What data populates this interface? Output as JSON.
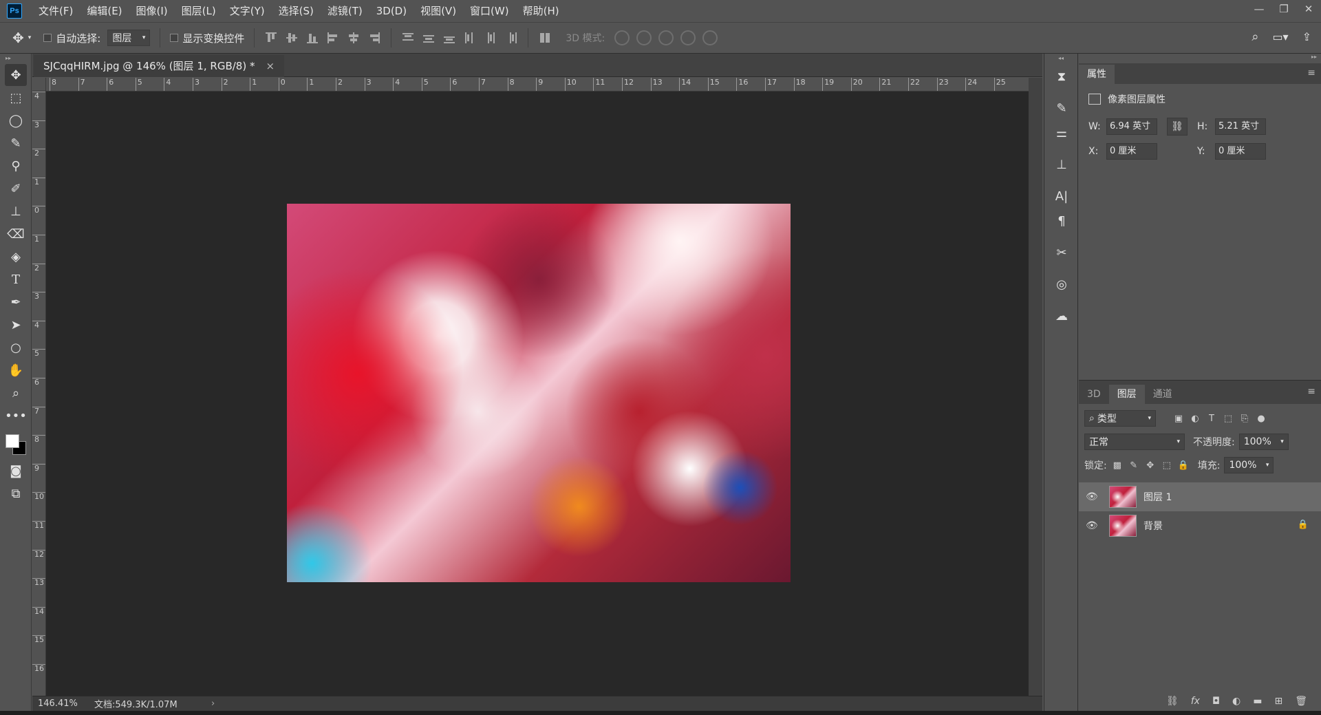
{
  "app": {
    "logo": "Ps"
  },
  "menu": [
    "文件(F)",
    "编辑(E)",
    "图像(I)",
    "图层(L)",
    "文字(Y)",
    "选择(S)",
    "滤镜(T)",
    "3D(D)",
    "视图(V)",
    "窗口(W)",
    "帮助(H)"
  ],
  "options": {
    "auto_select_label": "自动选择:",
    "auto_select_value": "图层",
    "show_transform_label": "显示变换控件",
    "mode_3d_label": "3D 模式:"
  },
  "document": {
    "tab_title": "SJCqqHIRM.jpg @ 146% (图层 1, RGB/8) *",
    "close_glyph": "×"
  },
  "rulers": {
    "horizontal": [
      "8",
      "7",
      "6",
      "5",
      "4",
      "3",
      "2",
      "1",
      "0",
      "1",
      "2",
      "3",
      "4",
      "5",
      "6",
      "7",
      "8",
      "9",
      "10",
      "11",
      "12",
      "13",
      "14",
      "15",
      "16",
      "17",
      "18",
      "19",
      "20",
      "21",
      "22",
      "23",
      "24",
      "25"
    ],
    "vertical": [
      "4",
      "3",
      "2",
      "1",
      "0",
      "1",
      "2",
      "3",
      "4",
      "5",
      "6",
      "7",
      "8",
      "9",
      "10",
      "11",
      "12",
      "13",
      "14",
      "15",
      "16"
    ]
  },
  "status": {
    "zoom": "146.41%",
    "doc_info": "文档:549.3K/1.07M",
    "arrow": "›"
  },
  "properties": {
    "tab": "属性",
    "section": "像素图层属性",
    "w_label": "W:",
    "w_value": "6.94 英寸",
    "h_label": "H:",
    "h_value": "5.21 英寸",
    "x_label": "X:",
    "x_value": "0 厘米",
    "y_label": "Y:",
    "y_value": "0 厘米"
  },
  "layers_panel": {
    "tabs": [
      "3D",
      "图层",
      "通道"
    ],
    "filter_label": "类型",
    "blend_mode": "正常",
    "opacity_label": "不透明度:",
    "opacity_value": "100%",
    "lock_label": "锁定:",
    "fill_label": "填充:",
    "fill_value": "100%",
    "layers": [
      {
        "name": "图层 1",
        "selected": true
      },
      {
        "name": "背景",
        "locked": true
      }
    ]
  }
}
